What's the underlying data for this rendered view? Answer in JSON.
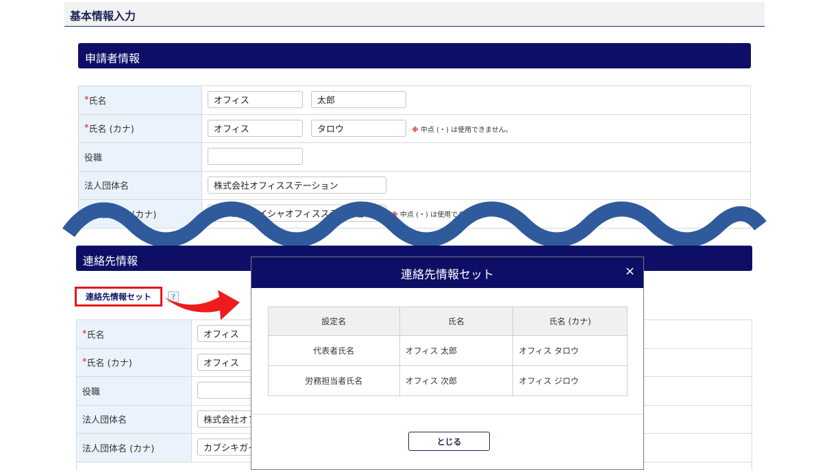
{
  "page": {
    "title": "基本情報入力"
  },
  "applicant": {
    "section_title": "申請者情報",
    "rows": [
      {
        "label": "氏名",
        "required": "*",
        "values": [
          "オフィス",
          "太郎"
        ],
        "note": ""
      },
      {
        "label": "氏名 (カナ)",
        "required": "*",
        "values": [
          "オフィス",
          "タロウ"
        ],
        "note_mark": "※",
        "note": "中点 (・) は使用できません。"
      },
      {
        "label": "役職",
        "required": "",
        "values": [
          ""
        ],
        "note": ""
      },
      {
        "label": "法人団体名",
        "required": "",
        "values": [
          "株式会社オフィスステーション"
        ],
        "note": ""
      },
      {
        "label": "法人団体名 (カナ)",
        "required": "",
        "values": [
          "カブシキガイシャオフィスステーション"
        ],
        "note_mark": "※",
        "note": "中点 (・) は使用できません。"
      }
    ]
  },
  "contact": {
    "section_title": "連絡先情報",
    "set_link": "連絡先情報セット",
    "help": "?",
    "rows": [
      {
        "label": "氏名",
        "required": "*",
        "values": [
          "オフィス"
        ]
      },
      {
        "label": "氏名 (カナ)",
        "required": "*",
        "values": [
          "オフィス"
        ]
      },
      {
        "label": "役職",
        "required": "",
        "values": [
          ""
        ]
      },
      {
        "label": "法人団体名",
        "required": "",
        "values": [
          "株式会社オフ"
        ]
      },
      {
        "label": "法人団体名 (カナ)",
        "required": "",
        "values": [
          "カブシキガイ"
        ]
      }
    ]
  },
  "modal": {
    "title": "連絡先情報セット",
    "close_icon": "×",
    "columns": [
      "設定名",
      "氏名",
      "氏名 (カナ)"
    ],
    "rows": [
      [
        "代表者氏名",
        "オフィス 太郎",
        "オフィス タロウ"
      ],
      [
        "労務担当者氏名",
        "オフィス 次郎",
        "オフィス ジロウ"
      ]
    ],
    "close_button": "とじる"
  },
  "colors": {
    "header_navy": "#0d0f66",
    "label_bg": "#eaf3fc",
    "required_red": "#d81b1b",
    "wave_blue": "#2f5b9c",
    "highlight_red": "#e8151b"
  },
  "icons": {
    "help": "help-icon",
    "close": "close-icon",
    "arrow": "red-arrow-icon"
  }
}
